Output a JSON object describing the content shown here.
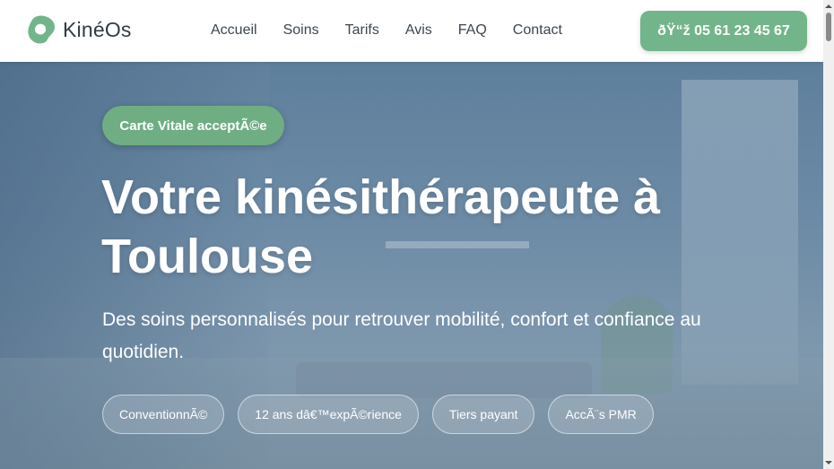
{
  "header": {
    "logo_text": "KinéOs",
    "logo_icon": "leaf-blob-logo-icon",
    "nav": [
      "Accueil",
      "Soins",
      "Tarifs",
      "Avis",
      "FAQ",
      "Contact"
    ],
    "phone_label": "ðŸ“ž 05 61 23 45 67"
  },
  "hero": {
    "badge": "Carte Vitale acceptÃ©e",
    "title": "Votre kinésithérapeute à Toulouse",
    "subtitle": "Des soins personnalisés pour retrouver mobilité, confort et confiance au quotidien.",
    "chips": [
      "ConventionnÃ©",
      "12 ans dâ€™expÃ©rience",
      "Tiers payant",
      "AccÃ¨s PMR"
    ]
  },
  "colors": {
    "accent": "#72b58a",
    "hero_overlay": "#6d8ba6",
    "nav_text": "#3a4650"
  }
}
